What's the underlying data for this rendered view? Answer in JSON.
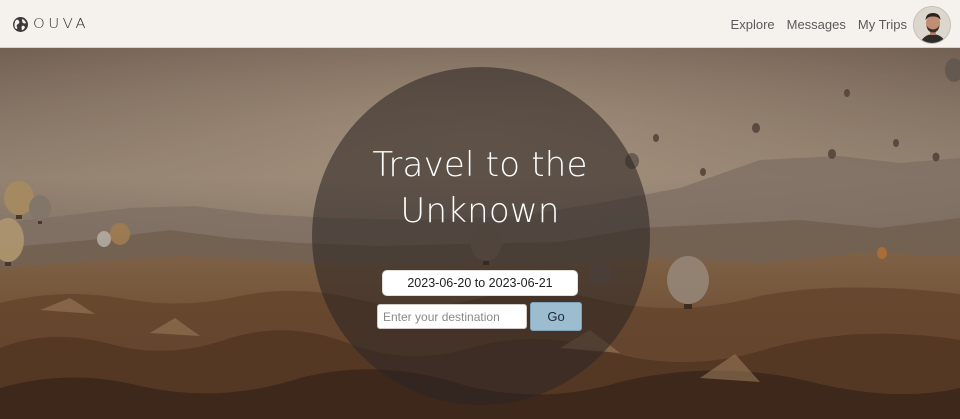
{
  "brand": {
    "name": "OUVA"
  },
  "nav": {
    "items": [
      {
        "label": "Explore"
      },
      {
        "label": "Messages"
      },
      {
        "label": "My Trips"
      }
    ]
  },
  "hero": {
    "title_line1": "Travel to the",
    "title_line2": "Unknown",
    "date_range": "2023-06-20 to 2023-06-21",
    "destination_placeholder": "Enter your destination",
    "destination_value": "",
    "go_label": "Go"
  },
  "colors": {
    "header_bg": "#f5f2ee",
    "go_button": "#9cbdd0",
    "overlay": "rgba(45,38,36,0.58)"
  }
}
